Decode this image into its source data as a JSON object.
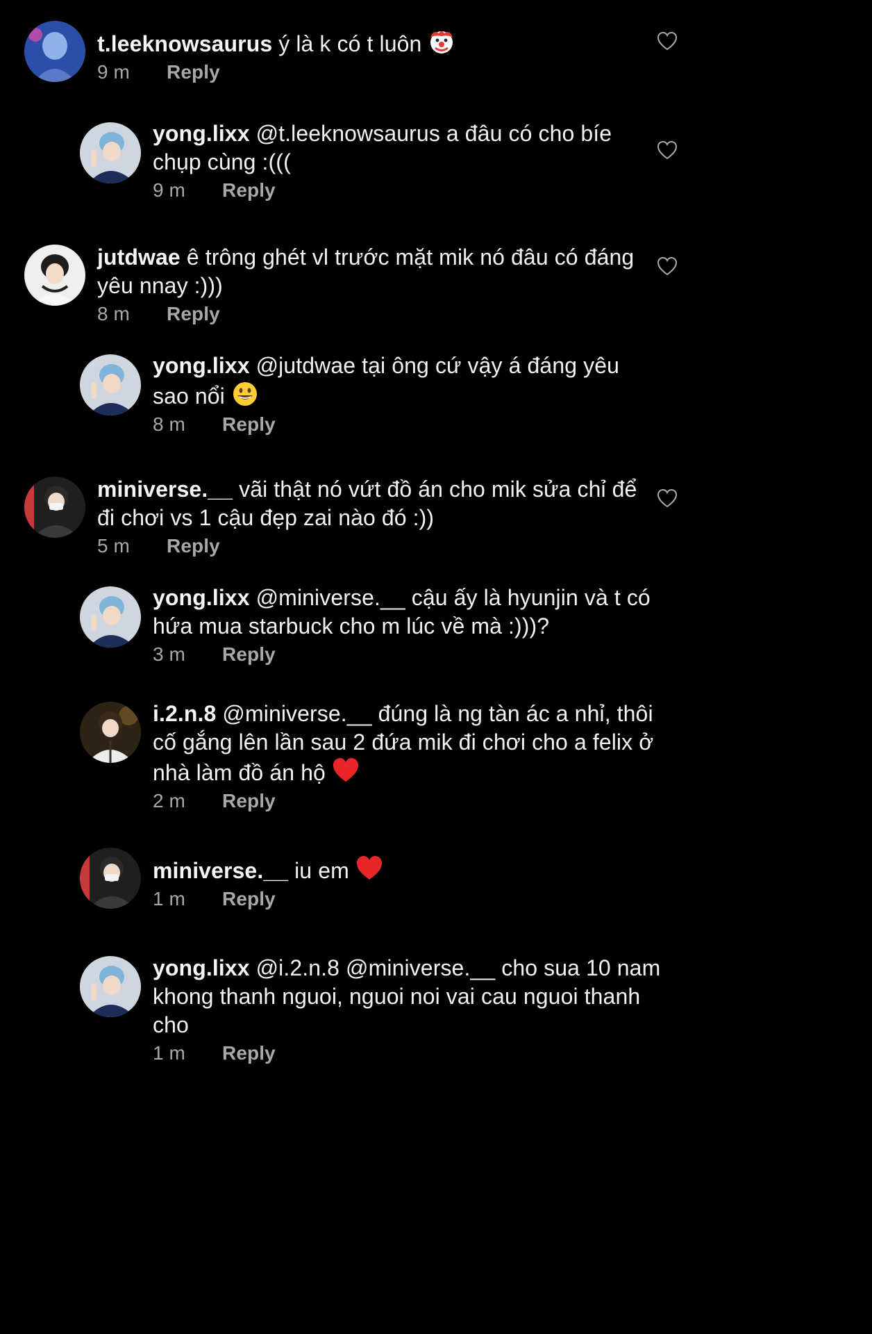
{
  "comments": [
    {
      "username": "t.leeknowsaurus",
      "text": " ý là k có t luôn",
      "emoji": "clown-face",
      "time": "9 m",
      "reply": "Reply",
      "avatar_colors": [
        "#2b4fa8",
        "#8fb3e8"
      ]
    },
    {
      "username": "yong.lixx",
      "text": " @t.leeknowsaurus a đâu có cho bíe chụp cùng :(((",
      "time": "9 m",
      "reply": "Reply",
      "avatar_colors": [
        "#dfe4ea",
        "#7fb3d9"
      ]
    },
    {
      "username": "jutdwae",
      "text": " ê trông ghét vl trước mặt mik nó đâu có đáng yêu nnay :)))",
      "time": "8 m",
      "reply": "Reply",
      "avatar_colors": [
        "#f1f1ef",
        "#1d1d1d"
      ]
    },
    {
      "username": "yong.lixx",
      "text": " @jutdwae tại ông cứ vậy á đáng yêu sao nổi",
      "emoji": "grinning-face",
      "time": "8 m",
      "reply": "Reply",
      "avatar_colors": [
        "#dfe4ea",
        "#7fb3d9"
      ]
    },
    {
      "username": "miniverse.__",
      "text": " vãi thật nó vứt đồ án cho mik sửa chỉ để đi chơi vs 1 cậu đẹp zai nào đó :))",
      "time": "5 m",
      "reply": "Reply",
      "avatar_colors": [
        "#2a2a2a",
        "#d04040"
      ]
    },
    {
      "username": "yong.lixx",
      "text": " @miniverse.__ cậu ấy là hyunjin và t có hứa mua starbuck cho m lúc về mà :)))?",
      "time": "3 m",
      "reply": "Reply",
      "avatar_colors": [
        "#dfe4ea",
        "#7fb3d9"
      ]
    },
    {
      "username": "i.2.n.8",
      "text": " @miniverse.__ đúng là ng tàn ác a nhỉ, thôi cố gắng lên lần sau 2 đứa mik đi chơi cho a felix ở nhà làm đồ án hộ",
      "emoji": "red-heart",
      "time": "2 m",
      "reply": "Reply",
      "avatar_colors": [
        "#3a2d1e",
        "#e8e8e8"
      ]
    },
    {
      "username": "miniverse.__",
      "text": " iu em",
      "emoji": "red-heart",
      "time": "1 m",
      "reply": "Reply",
      "avatar_colors": [
        "#2a2a2a",
        "#d04040"
      ]
    },
    {
      "username": "yong.lixx",
      "text": " @i.2.n.8 @miniverse.__ cho sua 10 nam khong thanh nguoi, nguoi noi vai cau nguoi thanh cho",
      "time": "1 m",
      "reply": "Reply",
      "avatar_colors": [
        "#dfe4ea",
        "#7fb3d9"
      ]
    }
  ],
  "colors": {
    "background": "#000000",
    "text": "#f2f2f2",
    "meta": "#a8a8a8"
  },
  "icons": {
    "like": "heart-outline-icon"
  }
}
